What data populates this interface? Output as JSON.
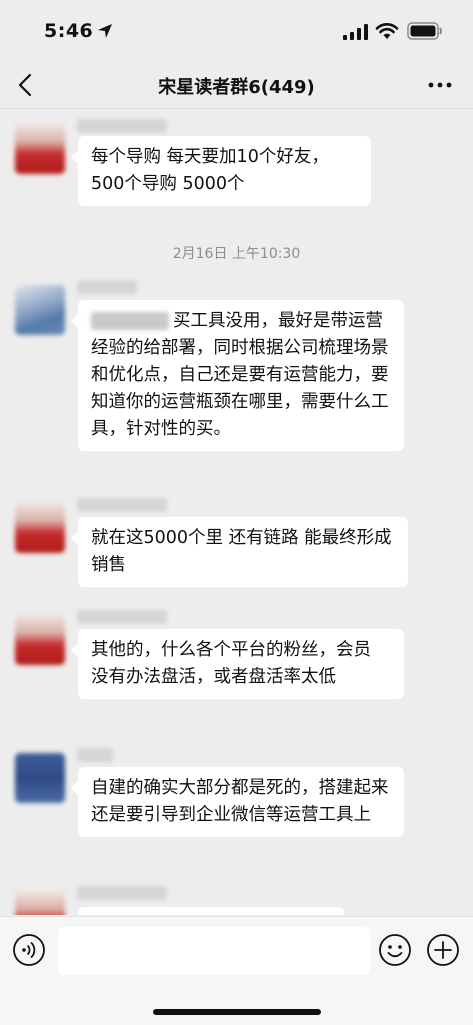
{
  "status_bar": {
    "time": "5:46"
  },
  "nav": {
    "title": "宋星读者群6(449)"
  },
  "messages": [
    {
      "text": "每个导购 每天要加10个好友，500个导购 5000个"
    },
    {
      "text": "买工具没用，最好是带运营经验的给部署，同时根据公司梳理场景和优化点，自己还是要有运营能力，要知道你的运营瓶颈在哪里，需要什么工具，针对性的买。"
    },
    {
      "text": "就在这5000个里 还有链路 能最终形成销售"
    },
    {
      "text": "其他的，什么各个平台的粉丝，会员 没有办法盘活，或者盘活率太低"
    },
    {
      "text": "自建的确实大部分都是死的，搭建起来还是要引导到企业微信等运营工具上"
    }
  ],
  "timestamps": {
    "t1": "2月16日 上午10:30"
  },
  "input": {
    "placeholder": ""
  },
  "colors": {
    "chat_background": "#ededed",
    "bubble": "#ffffff",
    "timestamp_text": "#8e8e8e"
  },
  "icons": [
    "location-arrow-icon",
    "signal-icon",
    "wifi-icon",
    "battery-icon",
    "back-icon",
    "more-icon",
    "voice-icon",
    "emoji-icon",
    "plus-icon"
  ]
}
